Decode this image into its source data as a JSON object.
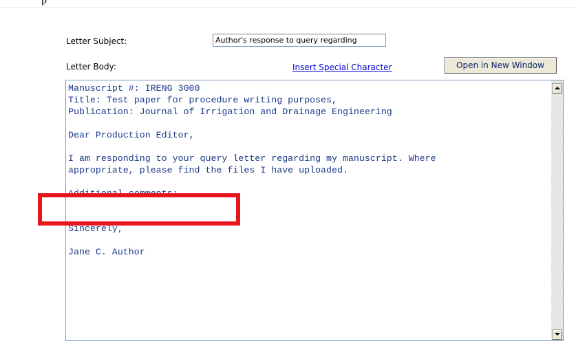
{
  "top_fragment": "p",
  "form": {
    "subject_label": "Letter Subject:",
    "subject_value": "Author's response to query regarding",
    "body_label": "Letter Body:",
    "insert_special_char_link": "Insert Special Character",
    "open_new_window_button": "Open in New Window"
  },
  "letter": {
    "lines": [
      "Manuscript #: IRENG 3000",
      "Title: Test paper for procedure writing purposes,",
      "Publication: Journal of Irrigation and Drainage Engineering",
      "",
      "Dear Production Editor,",
      "",
      "I am responding to your query letter regarding my manuscript. Where",
      "appropriate, please find the files I have uploaded.",
      "",
      "Additional comments:",
      "",
      "",
      "Sincerely,",
      "",
      "Jane C. Author"
    ]
  },
  "colors": {
    "highlight": "#e8141c",
    "letter_text": "#1a3a8a",
    "link": "#0000cc"
  },
  "icons": {
    "scroll_up": "scroll-up-arrow-icon",
    "scroll_down": "scroll-down-arrow-icon"
  }
}
